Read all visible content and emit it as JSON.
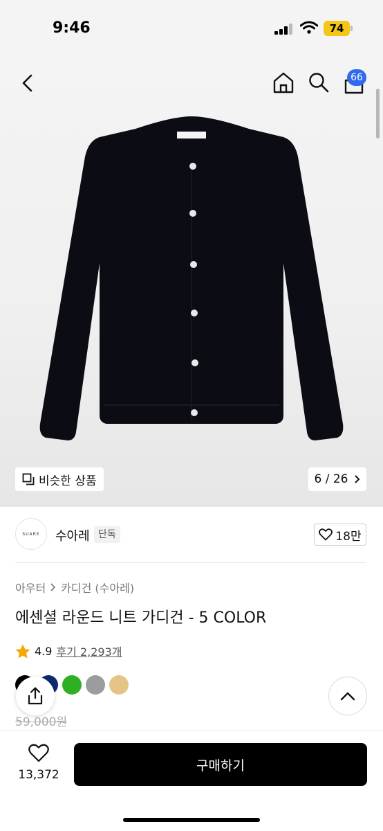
{
  "status_bar": {
    "time": "9:46",
    "battery": "74"
  },
  "header": {
    "cart_count": "66"
  },
  "product_image": {
    "brand_label": "SUARE"
  },
  "similar": {
    "label": "비슷한 상품"
  },
  "pager": {
    "current": "6",
    "separator": "/",
    "total": "26"
  },
  "brand": {
    "logo_text": "SUARE",
    "name": "수아레",
    "tag": "단독",
    "like_count": "18만"
  },
  "breadcrumb": {
    "level1": "아우터",
    "level2": "카디건 (수아레)"
  },
  "product": {
    "title": "에센셜 라운드 니트 가디건 - 5 COLOR",
    "rating": "4.9",
    "reviews": "후기 2,293개",
    "original_price": "59,000원"
  },
  "swatches": [
    "#000000",
    "#0d2a6b",
    "#2fb024",
    "#9c9c9c",
    "#e4c487"
  ],
  "bottom": {
    "wish_count": "13,372",
    "buy_label": "구매하기"
  },
  "colors": {
    "accent": "#2f6bef",
    "star": "#f6a700",
    "battery": "#f5c518"
  }
}
